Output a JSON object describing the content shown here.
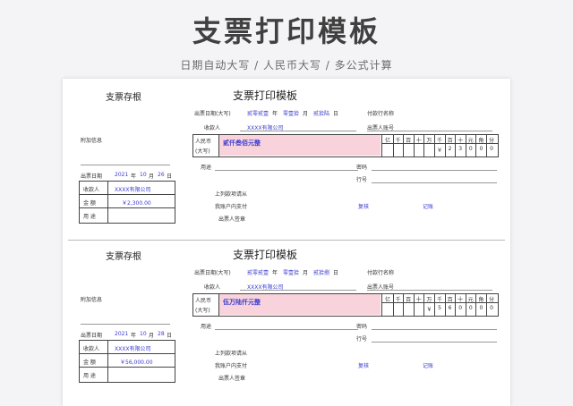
{
  "hero": {
    "title": "支票打印模板",
    "subtitle": "日期自动大写 / 人民币大写 / 多公式计算"
  },
  "labels": {
    "stub_title": "支票存根",
    "main_title": "支票打印模板",
    "attach_info": "附加信息",
    "issue_date": "出票日期",
    "year": "年",
    "month": "月",
    "day": "日",
    "payee": "收款人",
    "amount": "金  额",
    "usage": "用  途",
    "issue_date_upper": "出票日期(大写)",
    "payer_bank": "付款行名称",
    "payer_account": "出票人账号",
    "rmb": "人民币",
    "upper": "(大写)",
    "purpose": "用途",
    "code": "密码",
    "row": "行号",
    "above_amount": "上列款项请从",
    "my_account": "我账户内支付",
    "drawer_sign": "出票人签章",
    "reviewed": "复核",
    "recorded": "记账",
    "digit_headers": [
      "亿",
      "千",
      "百",
      "十",
      "万",
      "千",
      "百",
      "十",
      "元",
      "角",
      "分"
    ]
  },
  "cheques": [
    {
      "stub": {
        "year": "2021",
        "month": "10",
        "day": "26",
        "payee": "XXXX有限公司",
        "amount": "￥2,300.00"
      },
      "main": {
        "date_upper": [
          "贰零贰壹",
          "年",
          "零壹拾",
          "月",
          "贰拾陆",
          "日"
        ],
        "payee": "XXXX有限公司",
        "amount_words": "贰仟叁佰元整",
        "digits": [
          "",
          "",
          "",
          "",
          "",
          "￥",
          "2",
          "3",
          "0",
          "0",
          "0"
        ]
      }
    },
    {
      "stub": {
        "year": "2021",
        "month": "10",
        "day": "28",
        "payee": "XXXX有限公司",
        "amount": "￥56,000.00"
      },
      "main": {
        "date_upper": [
          "贰零贰壹",
          "年",
          "零壹拾",
          "月",
          "贰拾捌",
          "日"
        ],
        "payee": "XXXX有限公司",
        "amount_words": "伍万陆仟元整",
        "digits": [
          "",
          "",
          "",
          "",
          "￥",
          "5",
          "6",
          "0",
          "0",
          "0",
          "0"
        ]
      }
    }
  ]
}
